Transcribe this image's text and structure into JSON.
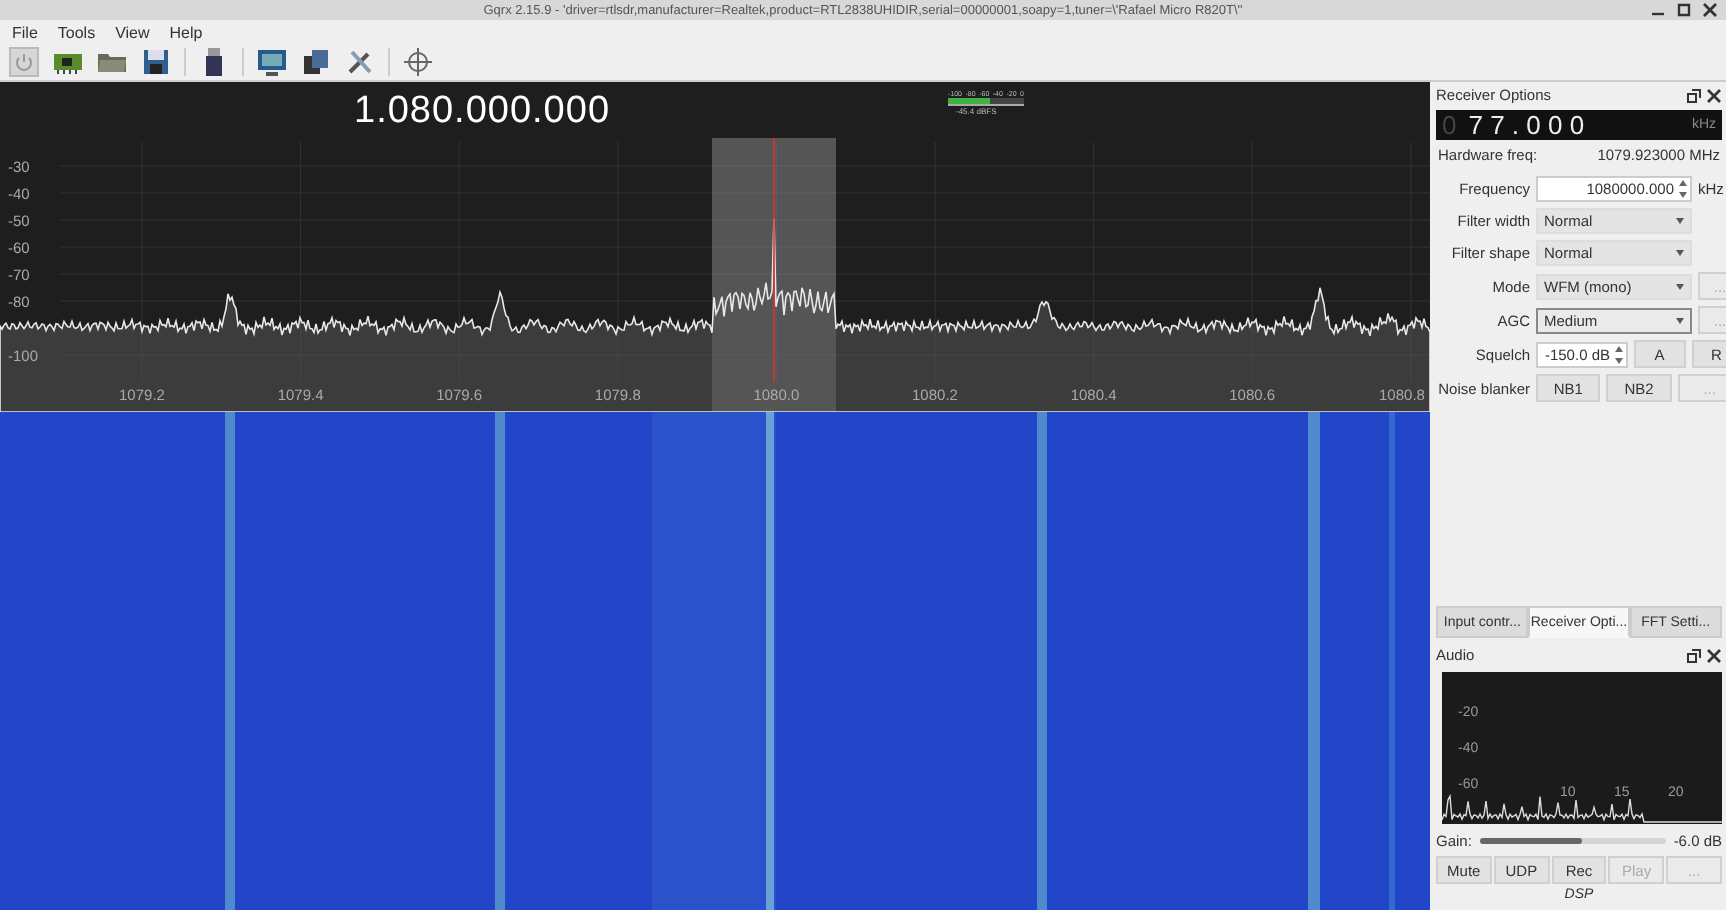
{
  "window": {
    "title": "Gqrx 2.15.9 - 'driver=rtlsdr,manufacturer=Realtek,product=RTL2838UHIDIR,serial=00000001,soapy=1,tuner=\\'Rafael Micro R820T\\''"
  },
  "menu": [
    "File",
    "Tools",
    "View",
    "Help"
  ],
  "spectrum": {
    "frequency": "1.080.000.000",
    "meter": {
      "scale": [
        "-100",
        "-80",
        "-60",
        "-40",
        "-20",
        "0"
      ],
      "level": 0.55,
      "reading": "-45.4 dBFS"
    },
    "y_ticks": [
      "-30",
      "-40",
      "-50",
      "-60",
      "-70",
      "-80",
      "-100"
    ],
    "x_ticks": [
      "1079.2",
      "1079.4",
      "1079.6",
      "1079.8",
      "1080.0",
      "1080.2",
      "1080.4",
      "1080.6",
      "1080.8"
    ]
  },
  "receiver_options": {
    "title": "Receiver Options",
    "offset": {
      "leading": "0",
      "value": "7 7 . 0 0 0",
      "unit": "kHz"
    },
    "hardware_freq": {
      "label": "Hardware freq:",
      "value": "1079.923000 MHz"
    },
    "rows": [
      {
        "kind": "spin",
        "label": "Frequency",
        "value": "1080000.000",
        "unit": "kHz"
      },
      {
        "kind": "select",
        "label": "Filter width",
        "value": "Normal",
        "focused": false
      },
      {
        "kind": "select",
        "label": "Filter shape",
        "value": "Normal",
        "focused": false
      },
      {
        "kind": "select",
        "label": "Mode",
        "value": "WFM (mono)",
        "focused": false,
        "buttons": [
          {
            "label": "...",
            "disabled": true
          }
        ]
      },
      {
        "kind": "select",
        "label": "AGC",
        "value": "Medium",
        "focused": true,
        "buttons": [
          {
            "label": "...",
            "disabled": true
          }
        ]
      },
      {
        "kind": "spin",
        "label": "Squelch",
        "value": "-150.0 dB",
        "buttons": [
          {
            "label": "A",
            "disabled": false
          },
          {
            "label": "R",
            "disabled": false
          }
        ]
      },
      {
        "kind": "buttons",
        "label": "Noise blanker",
        "buttons": [
          {
            "label": "NB1",
            "disabled": false
          },
          {
            "label": "NB2",
            "disabled": false
          },
          {
            "label": "...",
            "disabled": true
          }
        ]
      }
    ]
  },
  "tabs": [
    {
      "label": "Input contr...",
      "selected": false
    },
    {
      "label": "Receiver Opti...",
      "selected": true
    },
    {
      "label": "FFT Setti...",
      "selected": false
    }
  ],
  "audio": {
    "title": "Audio",
    "y_ticks": [
      "-20",
      "-40",
      "-60"
    ],
    "x_ticks": [
      "10",
      "15",
      "20"
    ],
    "gain": {
      "label": "Gain:",
      "level": 0.55,
      "reading": "-6.0 dB"
    },
    "buttons": [
      {
        "label": "Mute",
        "disabled": false
      },
      {
        "label": "UDP",
        "disabled": false
      },
      {
        "label": "Rec",
        "disabled": false
      },
      {
        "label": "Play",
        "disabled": true
      },
      {
        "label": "...",
        "disabled": true
      }
    ],
    "footer": "DSP"
  }
}
